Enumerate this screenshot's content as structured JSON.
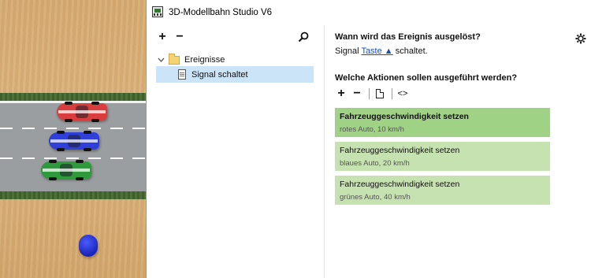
{
  "window": {
    "title": "3D-Modellbahn Studio V6"
  },
  "tree": {
    "toolbar": {
      "add_label": "+",
      "remove_label": "−",
      "search_icon": "search-icon"
    },
    "folder": {
      "label": "Ereignisse",
      "expanded": true
    },
    "items": [
      {
        "label": "Signal schaltet",
        "selected": true
      }
    ]
  },
  "trigger": {
    "heading": "Wann wird das Ereignis ausgelöst?",
    "prefix": "Signal",
    "link_label": "Taste ▲",
    "suffix": "schaltet."
  },
  "actions": {
    "heading": "Welche Aktionen sollen ausgeführt werden?",
    "toolbar": {
      "add_label": "+",
      "remove_label": "−",
      "code_label": "<>"
    },
    "items": [
      {
        "title": "Fahrzeuggeschwindigkeit setzen",
        "subtitle": "rotes Auto, 10 km/h",
        "selected": true
      },
      {
        "title": "Fahrzeuggeschwindigkeit setzen",
        "subtitle": "blaues Auto, 20 km/h",
        "selected": false
      },
      {
        "title": "Fahrzeuggeschwindigkeit setzen",
        "subtitle": "grünes Auto, 40 km/h",
        "selected": false
      }
    ]
  },
  "colors": {
    "selected_tree_item": "#cce4f7",
    "action_card": "#c6e2b1",
    "action_card_selected": "#9fd285",
    "link": "#1a4fb5",
    "car_red": "#d93d3d",
    "car_blue": "#2f3fd8",
    "car_green": "#2f9a3b"
  }
}
